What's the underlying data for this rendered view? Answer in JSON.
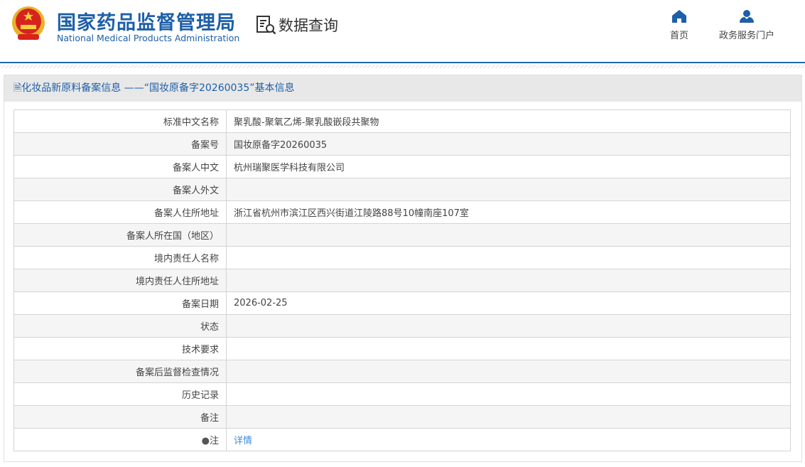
{
  "header": {
    "title_cn": "国家药品监督管理局",
    "title_en": "National Medical Products Administration",
    "section": "数据查询",
    "nav": [
      {
        "label": "首页",
        "icon": "home-icon"
      },
      {
        "label": "政务服务门户",
        "icon": "user-icon"
      }
    ]
  },
  "panel": {
    "title": "化妆品新原料备案信息 ——“国妆原备字20260035”基本信息"
  },
  "rows": [
    {
      "label": "标准中文名称",
      "value": "聚乳酸-聚氧乙烯-聚乳酸嵌段共聚物"
    },
    {
      "label": "备案号",
      "value": "国妆原备字20260035"
    },
    {
      "label": "备案人中文",
      "value": "杭州瑞聚医学科技有限公司"
    },
    {
      "label": "备案人外文",
      "value": ""
    },
    {
      "label": "备案人住所地址",
      "value": "浙江省杭州市滨江区西兴街道江陵路88号10幢南座107室"
    },
    {
      "label": "备案人所在国（地区）",
      "value": ""
    },
    {
      "label": "境内责任人名称",
      "value": ""
    },
    {
      "label": "境内责任人住所地址",
      "value": ""
    },
    {
      "label": "备案日期",
      "value": "2026-02-25"
    },
    {
      "label": "状态",
      "value": ""
    },
    {
      "label": "技术要求",
      "value": ""
    },
    {
      "label": "备案后监督检查情况",
      "value": ""
    },
    {
      "label": "历史记录",
      "value": ""
    },
    {
      "label": "备注",
      "value": ""
    }
  ],
  "note": {
    "label": "注",
    "link": "详情"
  }
}
